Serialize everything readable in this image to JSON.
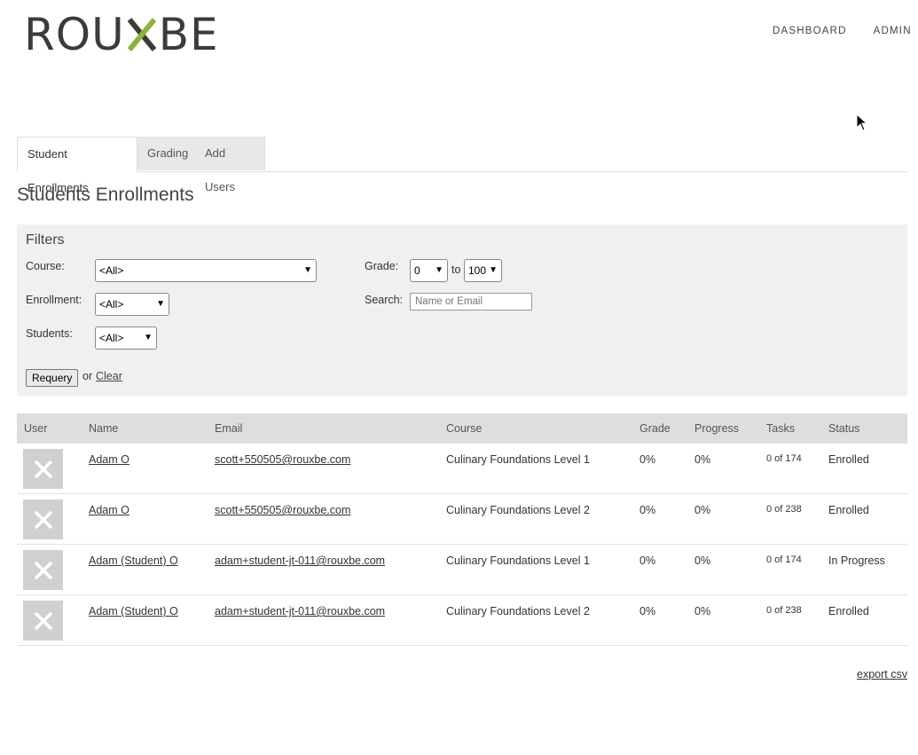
{
  "brand": {
    "logo_left": "ROU",
    "logo_right": "BE",
    "accent": "#8ab33f"
  },
  "nav": {
    "items": [
      "DASHBOARD",
      "ADMIN"
    ]
  },
  "tabs": [
    {
      "label": "Student Enrollments"
    },
    {
      "label": "Grading"
    },
    {
      "label": "Add Users"
    }
  ],
  "page": {
    "title": "Students Enrollments"
  },
  "filters": {
    "title": "Filters",
    "course_label": "Course:",
    "course_value": "<All>",
    "enrollment_label": "Enrollment:",
    "enrollment_value": "<All>",
    "students_label": "Students:",
    "students_value": "<All>",
    "grade_label": "Grade:",
    "grade_from": "0",
    "grade_to_word": "to",
    "grade_to": "100",
    "search_label": "Search:",
    "search_placeholder": "Name or Email",
    "requery_label": "Requery",
    "or_text": "or",
    "clear_label": "Clear"
  },
  "table": {
    "headers": [
      "User",
      "Name",
      "Email",
      "Course",
      "Grade",
      "Progress",
      "Tasks",
      "Status"
    ],
    "rows": [
      {
        "name": "Adam O",
        "email": "scott+550505@rouxbe.com",
        "course": "Culinary Foundations Level 1",
        "grade": "0%",
        "progress": "0%",
        "tasks": "0 of 174",
        "status": "Enrolled"
      },
      {
        "name": "Adam O",
        "email": "scott+550505@rouxbe.com",
        "course": "Culinary Foundations Level 2",
        "grade": "0%",
        "progress": "0%",
        "tasks": "0 of 238",
        "status": "Enrolled"
      },
      {
        "name": "Adam (Student) O",
        "email": "adam+student-jt-011@rouxbe.com",
        "course": "Culinary Foundations Level 1",
        "grade": "0%",
        "progress": "0%",
        "tasks": "0 of 174",
        "status": "In Progress"
      },
      {
        "name": "Adam (Student) O",
        "email": "adam+student-jt-011@rouxbe.com",
        "course": "Culinary Foundations Level 2",
        "grade": "0%",
        "progress": "0%",
        "tasks": "0 of 238",
        "status": "Enrolled"
      }
    ]
  },
  "export_label": "export csv"
}
